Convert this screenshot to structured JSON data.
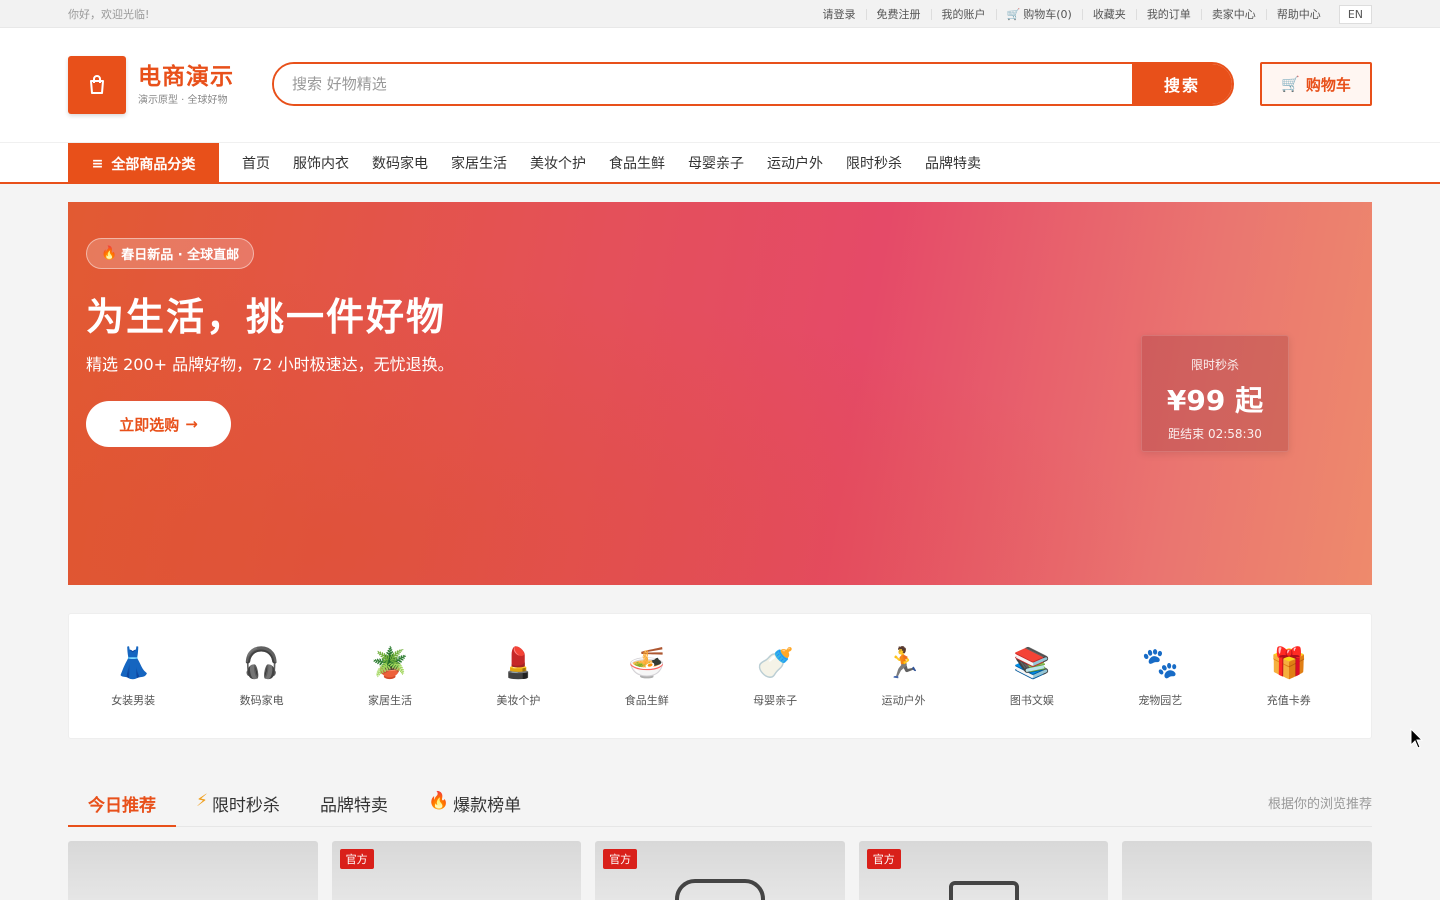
{
  "topbar": {
    "welcome": "你好，欢迎光临!",
    "links": [
      "请登录",
      "免费注册",
      "我的账户",
      "购物车(0)",
      "收藏夹",
      "我的订单",
      "卖家中心",
      "帮助中心"
    ],
    "lang": "EN"
  },
  "header": {
    "logo_title": "电商演示",
    "logo_sub": "演示原型 · 全球好物",
    "search_placeholder": "搜索 好物精选",
    "search_button": "搜索",
    "cart_button": "购物车"
  },
  "nav": {
    "all_categories": "全部商品分类",
    "items": [
      "首页",
      "服饰内衣",
      "数码家电",
      "家居生活",
      "美妆个护",
      "食品生鲜",
      "母婴亲子",
      "运动户外",
      "限时秒杀",
      "品牌特卖"
    ]
  },
  "banner": {
    "badge": "春日新品 · 全球直邮",
    "title": "为生活，挑一件好物",
    "description": "精选 200+ 品牌好物，72 小时极速达，无忧退换。",
    "cta": "立即选购",
    "flash_label": "限时秒杀",
    "flash_price": "¥99 起",
    "flash_countdown": "距结束 02:58:30",
    "colors": {
      "start": "#e25a32",
      "mid": "#e54a68",
      "end": "#ee8a6c"
    }
  },
  "categories": [
    {
      "icon": "👗",
      "label": "女装男装"
    },
    {
      "icon": "🎧",
      "label": "数码家电"
    },
    {
      "icon": "🪴",
      "label": "家居生活"
    },
    {
      "icon": "💄",
      "label": "美妆个护"
    },
    {
      "icon": "🍜",
      "label": "食品生鲜"
    },
    {
      "icon": "🍼",
      "label": "母婴亲子"
    },
    {
      "icon": "🏃",
      "label": "运动户外"
    },
    {
      "icon": "📚",
      "label": "图书文娱"
    },
    {
      "icon": "🐾",
      "label": "宠物园艺"
    },
    {
      "icon": "🎁",
      "label": "充值卡券"
    }
  ],
  "tabs": {
    "items": [
      "今日推荐",
      "限时秒杀",
      "品牌特卖",
      "爆款榜单"
    ],
    "hint": "根据你的浏览推荐"
  },
  "products": [
    {
      "tag": ""
    },
    {
      "tag": "官方"
    },
    {
      "tag": "官方"
    },
    {
      "tag": "官方"
    },
    {
      "tag": ""
    }
  ],
  "brand_color": "#e8501a"
}
